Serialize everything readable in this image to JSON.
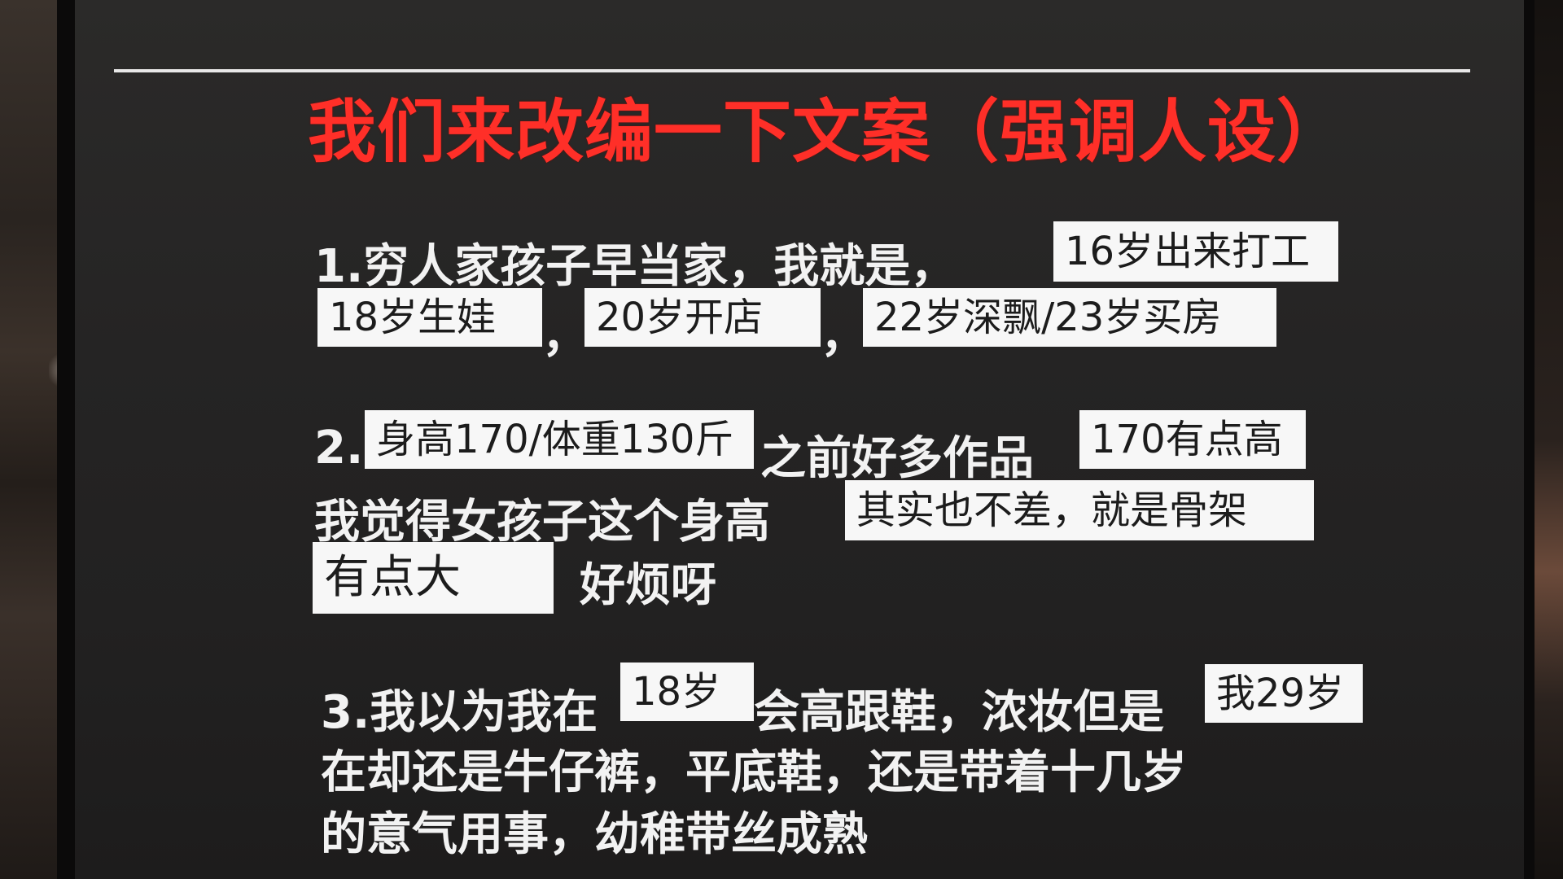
{
  "slide": {
    "title": "我们来改编一下文案（强调人设）",
    "item1": {
      "text": "1.穷人家孩子早当家，我就是，",
      "boxes": [
        "16岁出来打工",
        "18岁生娃",
        "20岁开店",
        "22岁深飘/23岁买房"
      ],
      "sep1": "，",
      "sep2": "，"
    },
    "item2": {
      "prefix": "2.",
      "box1": "身高170/体重130斤",
      "mid": "之前好多作品",
      "box2": "170有点高",
      "line2": "我觉得女孩子这个身高",
      "box3": "其实也不差，就是骨架",
      "box4": "有点大",
      "tail": "好烦呀"
    },
    "item3": {
      "text_a": "3.我以为我在",
      "box1": "18岁",
      "text_b": "会高跟鞋，浓妆但是",
      "box2": "我29岁",
      "line2": "在却还是牛仔裤，平底鞋，还是带着十几岁",
      "line3": "的意气用事，幼稚带丝成熟"
    }
  }
}
